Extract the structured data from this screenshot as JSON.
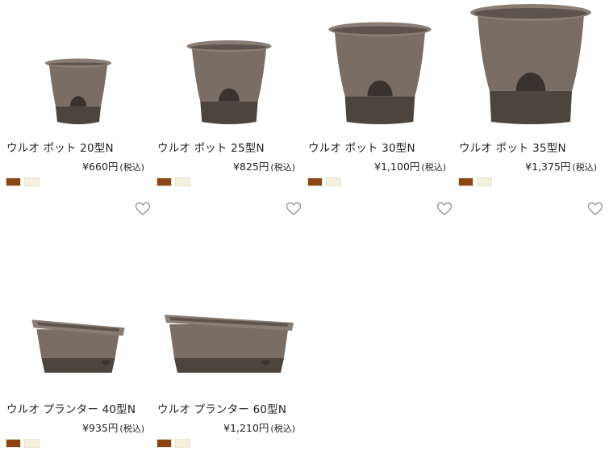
{
  "products": [
    {
      "name": "ウルオ ポット 20型N",
      "price": "¥660円",
      "tax": "(税込)",
      "swatches": [
        "#8b4513",
        "#f3f1dc"
      ],
      "shape": "pot",
      "scale": 0.55,
      "heart": true
    },
    {
      "name": "ウルオ ポット 25型N",
      "price": "¥825円",
      "tax": "(税込)",
      "swatches": [
        "#8b4513",
        "#f3f1dc"
      ],
      "shape": "pot",
      "scale": 0.7,
      "heart": true
    },
    {
      "name": "ウルオ ポット 30型N",
      "price": "¥1,100円",
      "tax": "(税込)",
      "swatches": [
        "#8b4513",
        "#f3f1dc"
      ],
      "shape": "pot",
      "scale": 0.85,
      "heart": true
    },
    {
      "name": "ウルオ ポット 35型N",
      "price": "¥1,375円",
      "tax": "(税込)",
      "swatches": [
        "#8b4513",
        "#f3f1dc"
      ],
      "shape": "pot",
      "scale": 1.0,
      "heart": true
    },
    {
      "name": "ウルオ プランター 40型N",
      "price": "¥935円",
      "tax": "(税込)",
      "swatches": [
        "#8b4513",
        "#f3f1dc"
      ],
      "shape": "planter",
      "scale": 0.72,
      "heart": false
    },
    {
      "name": "ウルオ プランター 60型N",
      "price": "¥1,210円",
      "tax": "(税込)",
      "swatches": [
        "#8b4513",
        "#f3f1dc"
      ],
      "shape": "planter",
      "scale": 1.0,
      "heart": false
    }
  ],
  "colors": {
    "pot_body": "#7a6d64",
    "pot_rim": "#8a7d73",
    "pot_inner": "#5f544d",
    "pot_base": "#4d443e",
    "heart": "#999999"
  }
}
